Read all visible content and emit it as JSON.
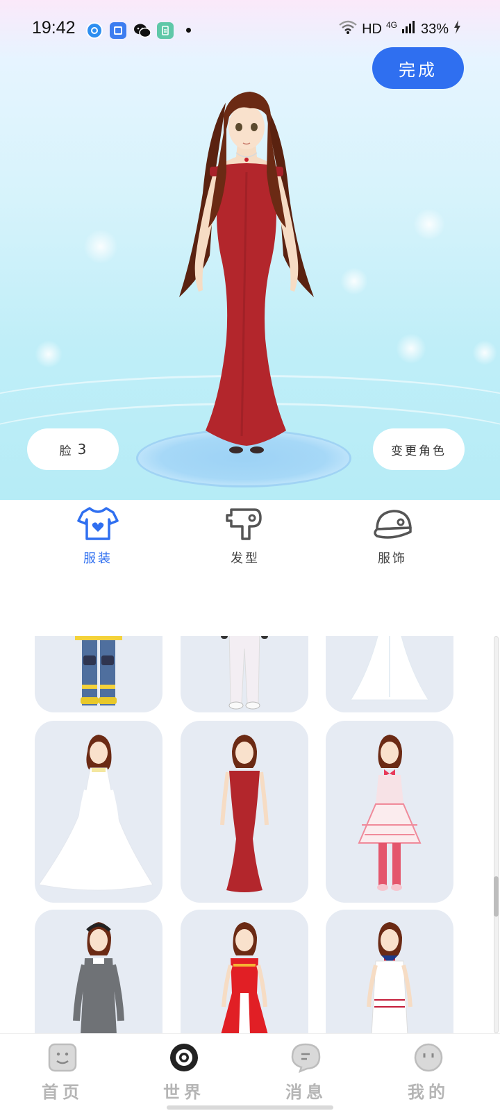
{
  "status_bar": {
    "time": "19:42",
    "network": "HD",
    "cellular": "4G",
    "battery": "33%"
  },
  "header": {
    "done_label": "完成"
  },
  "preview": {
    "face_label": "脸",
    "face_number": "3",
    "change_role_label": "变更角色"
  },
  "category_tabs": [
    {
      "label": "服装",
      "icon": "tshirt-heart-icon",
      "active": true
    },
    {
      "label": "发型",
      "icon": "hair-dryer-icon",
      "active": false
    },
    {
      "label": "服饰",
      "icon": "cap-icon",
      "active": false
    }
  ],
  "outfits": [
    {
      "name": "firefighter-outfit",
      "row": 0,
      "col": 0
    },
    {
      "name": "white-pants-outfit",
      "row": 0,
      "col": 1
    },
    {
      "name": "white-gown-outfit",
      "row": 0,
      "col": 2
    },
    {
      "name": "wedding-dress",
      "row": 1,
      "col": 0
    },
    {
      "name": "red-evening-dress",
      "row": 1,
      "col": 1,
      "selected": true
    },
    {
      "name": "pink-lolita-dress",
      "row": 1,
      "col": 2
    },
    {
      "name": "nun-dress",
      "row": 2,
      "col": 0
    },
    {
      "name": "red-idol-dress",
      "row": 2,
      "col": 1
    },
    {
      "name": "sailor-uniform",
      "row": 2,
      "col": 2
    }
  ],
  "bottom_nav": [
    {
      "label": "首页",
      "icon": "face-square-icon",
      "active": false
    },
    {
      "label": "世界",
      "icon": "target-circle-icon",
      "active": true
    },
    {
      "label": "消息",
      "icon": "chat-bubble-icon",
      "active": false
    },
    {
      "label": "我的",
      "icon": "smiley-icon",
      "active": false
    }
  ],
  "colors": {
    "accent": "#2f6ff0",
    "dress_red": "#b3262c",
    "hair_brown": "#6b2a14",
    "tile_bg": "#e6ebf3"
  }
}
